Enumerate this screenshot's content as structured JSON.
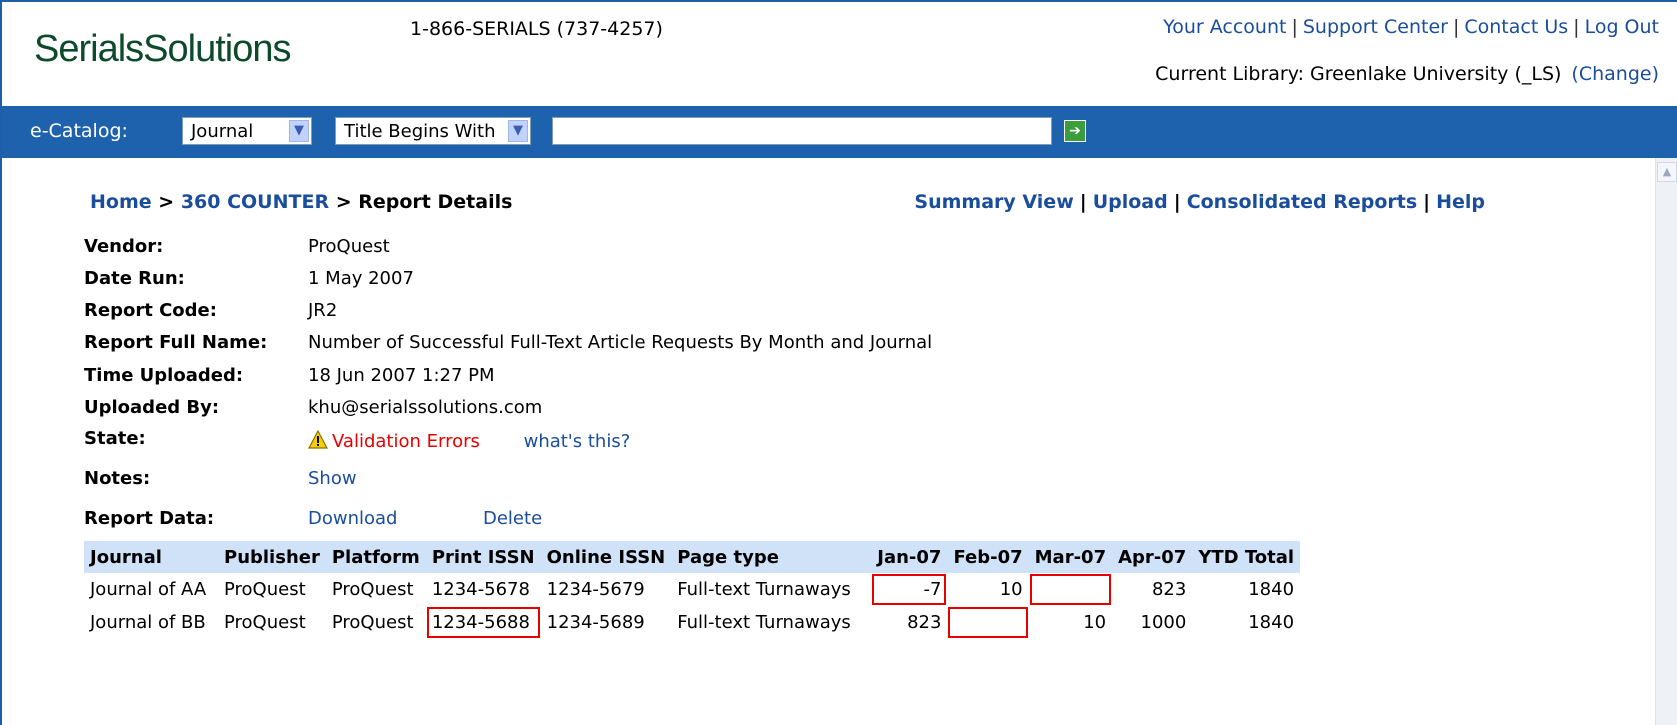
{
  "header": {
    "logo": "SerialsSolutions",
    "phone": "1-866-SERIALS (737-4257)",
    "links": [
      "Your Account",
      "Support Center",
      "Contact Us",
      "Log Out"
    ],
    "library_label": "Current Library: Greenlake University (_LS)",
    "change_link": "(Change)"
  },
  "search": {
    "label": "e-Catalog:",
    "type_selected": "Journal",
    "mode_selected": "Title Begins With",
    "query": "",
    "go_icon": "green-arrow-right-icon"
  },
  "breadcrumb": {
    "home": "Home",
    "section": "360 COUNTER",
    "current": "Report Details",
    "sep": ">"
  },
  "nav": {
    "summary": "Summary View",
    "upload": "Upload",
    "consolidated": "Consolidated Reports",
    "help": "Help"
  },
  "details": {
    "vendor_label": "Vendor:",
    "vendor": "ProQuest",
    "date_label": "Date Run:",
    "date": "1 May 2007",
    "code_label": "Report Code:",
    "code": "JR2",
    "fullname_label": "Report Full Name:",
    "fullname": "Number of Successful Full-Text Article Requests By Month and Journal",
    "time_label": "Time Uploaded:",
    "time": "18 Jun 2007 1:27 PM",
    "by_label": "Uploaded By:",
    "by": "khu@serialssolutions.com",
    "state_label": "State:",
    "state": "Validation Errors",
    "state_help": "what's this?",
    "notes_label": "Notes:",
    "notes_link": "Show",
    "data_label": "Report Data:",
    "download": "Download",
    "delete": "Delete"
  },
  "table": {
    "columns": [
      "Journal",
      "Publisher",
      "Platform",
      "Print ISSN",
      "Online ISSN",
      "Page type",
      "Jan-07",
      "Feb-07",
      "Mar-07",
      "Apr-07",
      "YTD Total"
    ],
    "rows": [
      [
        "Journal of AA",
        "ProQuest",
        "ProQuest",
        "1234-5678",
        "1234-5679",
        "Full-text Turnaways",
        "-7",
        "10",
        "",
        "823",
        "1840"
      ],
      [
        "Journal of BB",
        "ProQuest",
        "ProQuest",
        "1234-5688",
        "1234-5689",
        "Full-text Turnaways",
        "823",
        "",
        "10",
        "1000",
        "1840"
      ]
    ]
  },
  "colors": {
    "brand_blue": "#1e62ad",
    "logo_green": "#0c4a2a",
    "error_red": "#e60000",
    "header_cell": "#cfe2f7"
  }
}
